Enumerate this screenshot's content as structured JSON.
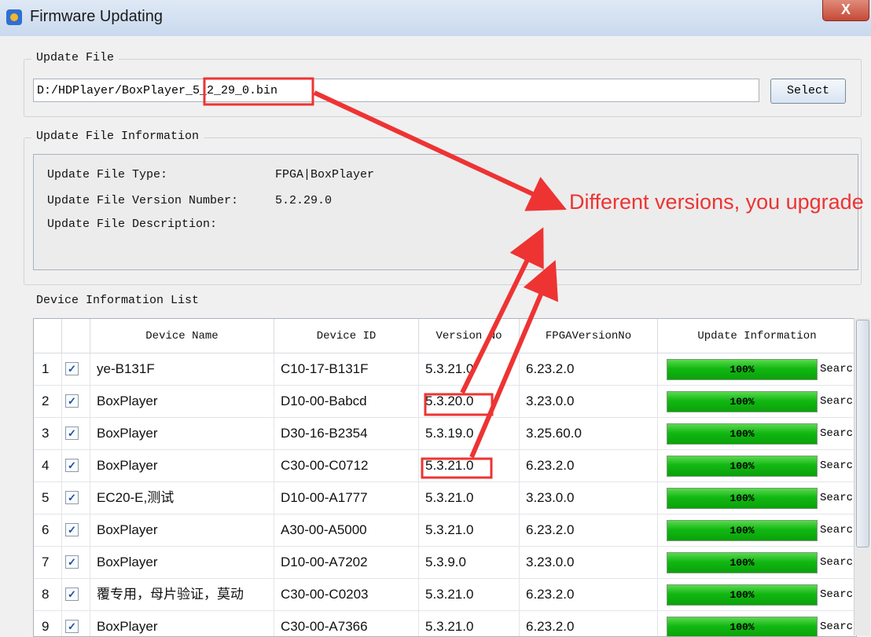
{
  "window": {
    "title": "Firmware Updating",
    "close_label": "X"
  },
  "update_file": {
    "legend": "Update File",
    "path": "D:/HDPlayer/BoxPlayer_5_2_29_0.bin",
    "select_label": "Select"
  },
  "update_file_info": {
    "legend": "Update File Information",
    "type_label": "Update File Type:",
    "type_value": "FPGA|BoxPlayer",
    "version_label": "Update File Version Number:",
    "version_value": "5.2.29.0",
    "description_label": "Update File Description:"
  },
  "device_list": {
    "legend": "Device Information List",
    "columns": [
      "Device Name",
      "Device ID",
      "Version No",
      "FPGAVersionNo",
      "Update Information"
    ],
    "rows": [
      {
        "num": "1",
        "name": "ye-B131F",
        "id": "C10-17-B131F",
        "version": "5.3.21.0",
        "fpga": "6.23.2.0",
        "progress": "100%",
        "status": "Searc"
      },
      {
        "num": "2",
        "name": "BoxPlayer",
        "id": "D10-00-Babcd",
        "version": "5.3.20.0",
        "fpga": "3.23.0.0",
        "progress": "100%",
        "status": "Searc"
      },
      {
        "num": "3",
        "name": "BoxPlayer",
        "id": "D30-16-B2354",
        "version": "5.3.19.0",
        "fpga": "3.25.60.0",
        "progress": "100%",
        "status": "Searc"
      },
      {
        "num": "4",
        "name": "BoxPlayer",
        "id": "C30-00-C0712",
        "version": "5.3.21.0",
        "fpga": "6.23.2.0",
        "progress": "100%",
        "status": "Searc"
      },
      {
        "num": "5",
        "name": "EC20-E,测试",
        "id": "D10-00-A1777",
        "version": "5.3.21.0",
        "fpga": "3.23.0.0",
        "progress": "100%",
        "status": "Searc"
      },
      {
        "num": "6",
        "name": "BoxPlayer",
        "id": "A30-00-A5000",
        "version": "5.3.21.0",
        "fpga": "6.23.2.0",
        "progress": "100%",
        "status": "Searc"
      },
      {
        "num": "7",
        "name": "BoxPlayer",
        "id": "D10-00-A7202",
        "version": "5.3.9.0",
        "fpga": "3.23.0.0",
        "progress": "100%",
        "status": "Searc"
      },
      {
        "num": "8",
        "name": "覆专用，母片验证，莫动",
        "id": "C30-00-C0203",
        "version": "5.3.21.0",
        "fpga": "6.23.2.0",
        "progress": "100%",
        "status": "Searc"
      },
      {
        "num": "9",
        "name": "BoxPlayer",
        "id": "C30-00-A7366",
        "version": "5.3.21.0",
        "fpga": "6.23.2.0",
        "progress": "100%",
        "status": "Searc"
      }
    ]
  },
  "annotation": {
    "text": "Different versions, you upgrade",
    "color": "#ee3333"
  }
}
